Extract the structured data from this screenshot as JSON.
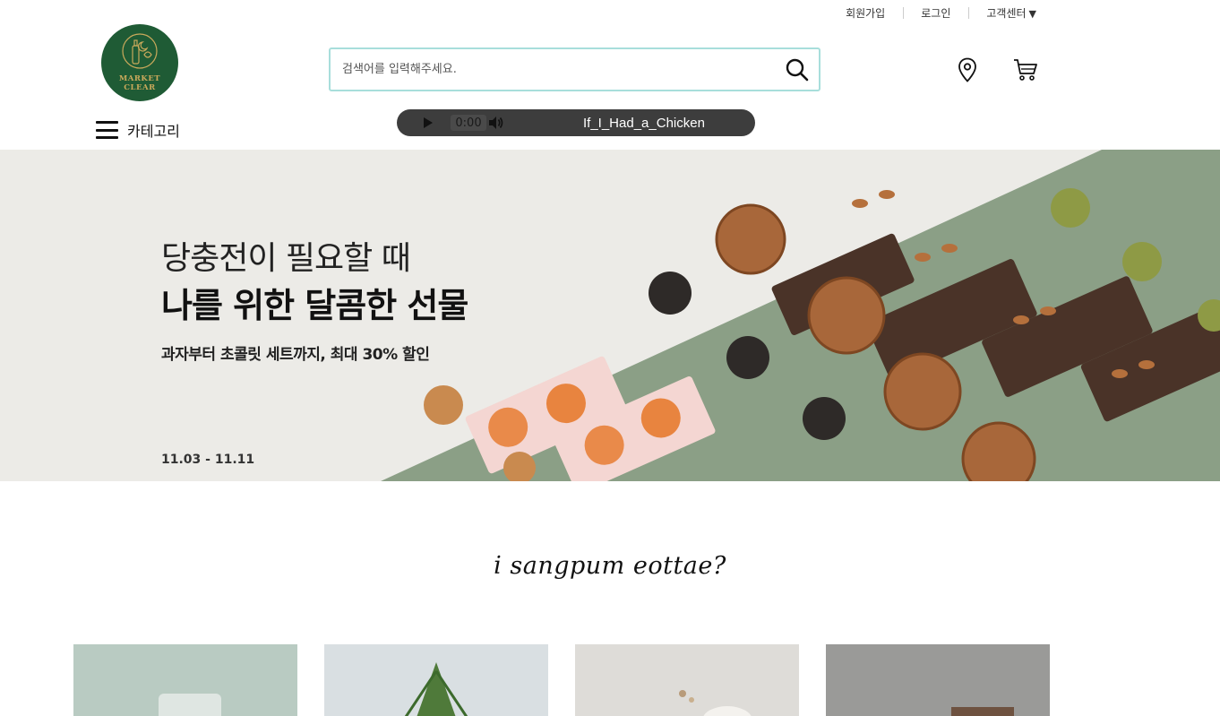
{
  "header": {
    "util_links": {
      "signup": "회원가입",
      "login": "로그인",
      "support": "고객센터",
      "support_caret": "▼"
    },
    "logo": {
      "line1": "MARKET",
      "line2": "CLEAR"
    },
    "search": {
      "placeholder": "검색어를 입력해주세요.",
      "value": ""
    },
    "category_label": "카테고리"
  },
  "player": {
    "time": "0:00",
    "track": "If_I_Had_a_Chicken"
  },
  "hero": {
    "line1": "당충전이 필요할 때",
    "line2": "나를 위한 달콤한 선물",
    "line3": "과자부터 초콜릿 세트까지, 최대 30% 할인",
    "date": "11.03 - 11.11"
  },
  "section": {
    "title": "i sangpum eottae?"
  },
  "products": [
    {
      "name": "product-card-1",
      "bg": "#b9cbc2"
    },
    {
      "name": "product-card-2",
      "bg": "#d9dfe2"
    },
    {
      "name": "product-card-3",
      "bg": "#dedcd8"
    },
    {
      "name": "product-card-4",
      "bg": "#9a9a98"
    }
  ],
  "colors": {
    "logo_green": "#1f5b35",
    "logo_gold": "#c9a95b",
    "search_border": "#a8dedb",
    "hero_green": "#8b9f86",
    "hero_light": "#ecebe7"
  }
}
